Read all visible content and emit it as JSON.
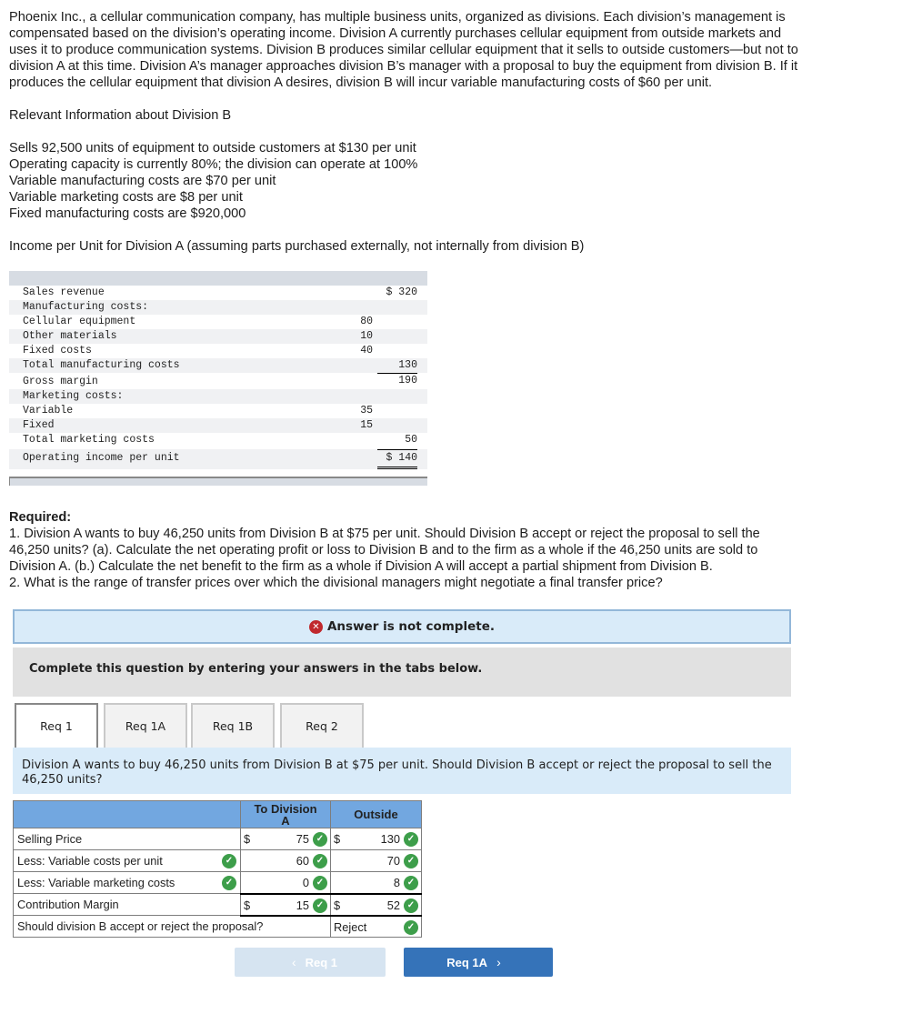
{
  "intro": {
    "lines": [
      "Phoenix Inc., a cellular communication company, has multiple business units, organized as divisions. Each division’s management is",
      "compensated based on the division’s operating income. Division A currently purchases cellular equipment from outside markets and",
      "uses it to produce communication systems. Division B produces similar cellular equipment that it sells to outside customers—but not to",
      "division A at this time. Division A’s manager approaches division B’s manager with a proposal to buy the equipment from division B. If it",
      "produces the cellular equipment that division A desires, division B will incur variable manufacturing costs of $60 per unit."
    ]
  },
  "division_b": {
    "heading": "Relevant Information about Division B",
    "facts": [
      "Sells 92,500 units of equipment to outside customers at $130 per unit",
      "Operating capacity is currently 80%; the division can operate at 100%",
      "Variable manufacturing costs are $70 per unit",
      "Variable marketing costs are $8 per unit",
      "Fixed manufacturing costs are $920,000"
    ]
  },
  "division_a": {
    "heading": "Income per Unit for Division A (assuming parts purchased externally, not internally from division B)",
    "rows": [
      {
        "label": "Sales revenue",
        "c1": "",
        "c2": "$ 320"
      },
      {
        "label": "Manufacturing costs:",
        "c1": "",
        "c2": ""
      },
      {
        "label": "Cellular equipment",
        "c1": "80",
        "c2": ""
      },
      {
        "label": "Other materials",
        "c1": "10",
        "c2": ""
      },
      {
        "label": "Fixed costs",
        "c1": "40",
        "c2": ""
      },
      {
        "label": "Total manufacturing costs",
        "c1": "",
        "c2": "130"
      },
      {
        "label": "Gross margin",
        "c1": "",
        "c2": "190"
      },
      {
        "label": "Marketing costs:",
        "c1": "",
        "c2": ""
      },
      {
        "label": "Variable",
        "c1": "35",
        "c2": ""
      },
      {
        "label": "Fixed",
        "c1": "15",
        "c2": ""
      },
      {
        "label": "Total marketing costs",
        "c1": "",
        "c2": "50"
      },
      {
        "label": "Operating income per unit",
        "c1": "",
        "c2": "$ 140"
      }
    ]
  },
  "required": {
    "heading": "Required:",
    "lines": [
      "1. Division A wants to buy 46,250 units from Division B at $75 per unit. Should Division B accept or reject the proposal to sell the",
      "46,250 units? (a). Calculate the net operating profit or loss to Division B and to the firm as a whole if the 46,250 units are sold to",
      "Division A. (b.) Calculate the net benefit to the firm as a whole if Division A will accept a partial shipment from Division B.",
      "2. What is the range of transfer prices over which the divisional managers might negotiate a final transfer price?"
    ]
  },
  "status": {
    "icon": "x-circle-icon",
    "text": "Answer is not complete."
  },
  "instructions": "Complete this question by entering your answers in the tabs below.",
  "tabs": [
    {
      "label": "Req 1",
      "active": true
    },
    {
      "label": "Req 1A",
      "active": false
    },
    {
      "label": "Req 1B",
      "active": false
    },
    {
      "label": "Req 2",
      "active": false
    }
  ],
  "tab_content": {
    "question_line1": "Division A wants to buy 46,250 units from Division B at $75 per unit. Should Division B accept or reject the proposal to sell the",
    "question_line2": "46,250 units?"
  },
  "answer_table": {
    "headers": {
      "col1": "",
      "col2_line1": "To Division",
      "col2_line2": "A",
      "col3": "Outside"
    },
    "rows": [
      {
        "label": "Selling Price",
        "label_check": false,
        "a_dollar": "$",
        "a_value": "75",
        "b_dollar": "$",
        "b_value": "130"
      },
      {
        "label": "Less: Variable costs per unit",
        "label_check": true,
        "a_dollar": "",
        "a_value": "60",
        "b_dollar": "",
        "b_value": "70"
      },
      {
        "label": "Less: Variable marketing costs",
        "label_check": true,
        "a_dollar": "",
        "a_value": "0",
        "b_dollar": "",
        "b_value": "8"
      },
      {
        "label": "Contribution Margin",
        "label_check": false,
        "a_dollar": "$",
        "a_value": "15",
        "b_dollar": "$",
        "b_value": "52"
      }
    ],
    "decision": {
      "label": "Should division B accept or reject the proposal?",
      "value": "Reject"
    },
    "check_glyph": "✓"
  },
  "nav": {
    "prev_label": "Req 1",
    "next_label": "Req 1A",
    "prev_chevron": "‹",
    "next_chevron": "›"
  }
}
